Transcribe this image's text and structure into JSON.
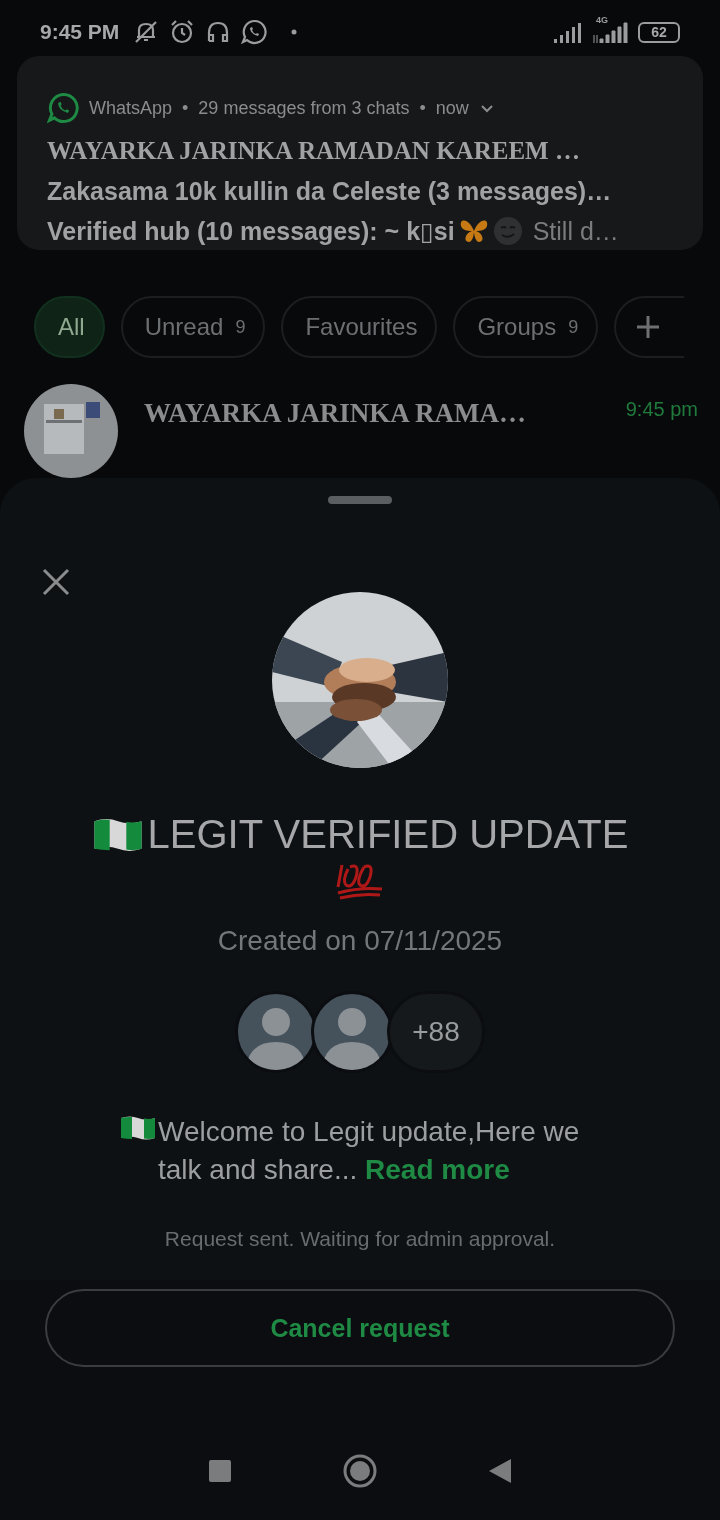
{
  "status_bar": {
    "time": "9:45 PM",
    "network": "4G",
    "battery": "62"
  },
  "notification": {
    "app": "WhatsApp",
    "separator": "•",
    "summary": "29 messages from 3 chats",
    "time": "now",
    "lines": [
      {
        "kind": "title",
        "text": "WAYARKA JARINKA RAMADAN KAREEM …"
      },
      {
        "kind": "plain",
        "text": "Zakasama 10k kullin da Celeste (3 messages)…"
      },
      {
        "kind": "emoji",
        "text": "Verified hub (10 messages): ~ k▯si",
        "tail": "Still d…"
      }
    ]
  },
  "filters": [
    {
      "label": "All",
      "selected": true
    },
    {
      "label": "Unread",
      "count": "9",
      "selected": false
    },
    {
      "label": "Favourites",
      "selected": false
    },
    {
      "label": "Groups",
      "count": "9",
      "selected": false
    }
  ],
  "chat": {
    "title": "WAYARKA JARINKA RAMA…",
    "time": "9:45 pm"
  },
  "group": {
    "name": "LEGIT VERIFIED UPDATE",
    "created": "Created on 07/11/2025",
    "member_more": "+88",
    "description": "Welcome to Legit update,Here we talk and share...",
    "read_more": "Read more",
    "status": "Request sent. Waiting for admin approval."
  },
  "action": {
    "label": "Cancel request"
  }
}
